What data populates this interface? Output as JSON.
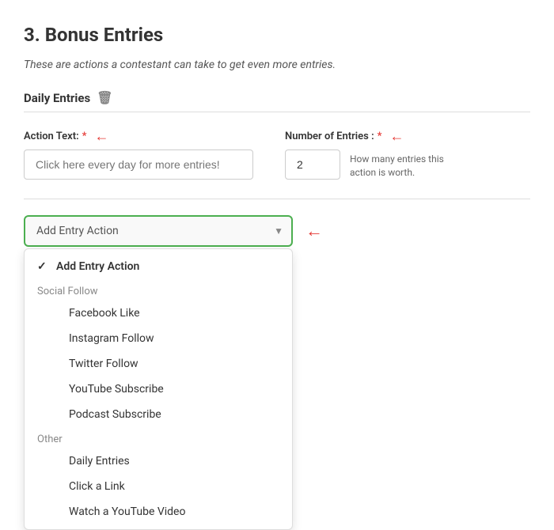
{
  "page": {
    "title_number": "3.",
    "title_text": "Bonus Entries",
    "subtitle": "These are actions a contestant can take to get even more entries."
  },
  "daily_entries_section": {
    "label": "Daily Entries",
    "action_text_label": "Action Text:",
    "action_text_placeholder": "Click here every day for more entries!",
    "number_of_entries_label": "Number of Entries :",
    "number_of_entries_value": "2",
    "entries_hint": "How many entries this action is worth."
  },
  "dropdown": {
    "placeholder": "Add Entry Action",
    "selected_item": "Add Entry Action",
    "groups": [
      {
        "label": "Social Follow",
        "items": [
          {
            "label": "Facebook Like"
          },
          {
            "label": "Instagram Follow"
          },
          {
            "label": "Twitter Follow"
          },
          {
            "label": "YouTube Subscribe"
          },
          {
            "label": "Podcast Subscribe"
          }
        ]
      },
      {
        "label": "Other",
        "items": [
          {
            "label": "Daily Entries"
          },
          {
            "label": "Click a Link"
          },
          {
            "label": "Watch a YouTube Video"
          }
        ]
      }
    ]
  }
}
